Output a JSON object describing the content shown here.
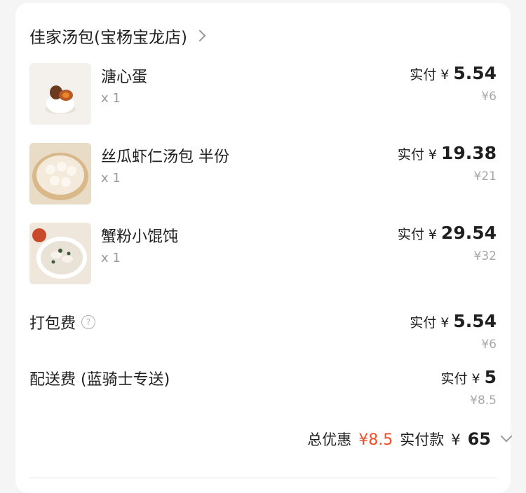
{
  "store": {
    "name": "佳家汤包(宝杨宝龙店)",
    "chevron_icon": "chevron-right-icon"
  },
  "items": [
    {
      "name": "溏心蛋",
      "qty": "x 1",
      "paid_label": "实付",
      "paid_currency": "¥",
      "paid_amount": "5.54",
      "original": "¥6"
    },
    {
      "name": "丝瓜虾仁汤包 半份",
      "qty": "x 1",
      "paid_label": "实付",
      "paid_currency": "¥",
      "paid_amount": "19.38",
      "original": "¥21"
    },
    {
      "name": "蟹粉小馄饨",
      "qty": "x 1",
      "paid_label": "实付",
      "paid_currency": "¥",
      "paid_amount": "29.54",
      "original": "¥32"
    }
  ],
  "packing_fee": {
    "title": "打包费",
    "help_icon": "question-circle-icon",
    "help_glyph": "?",
    "paid_label": "实付",
    "paid_currency": "¥",
    "paid_amount": "5.54",
    "original": "¥6"
  },
  "delivery_fee": {
    "title": "配送费 (蓝骑士专送)",
    "paid_label": "实付",
    "paid_currency": "¥",
    "paid_amount": "5",
    "original": "¥8.5"
  },
  "summary": {
    "discount_label": "总优惠",
    "discount_value": "¥8.5",
    "paid_label": "实付款",
    "paid_currency": "¥",
    "paid_amount": "65"
  },
  "colors": {
    "accent_red": "#f04e2a",
    "muted": "#a8a8a8",
    "text": "#1f1f1f"
  }
}
